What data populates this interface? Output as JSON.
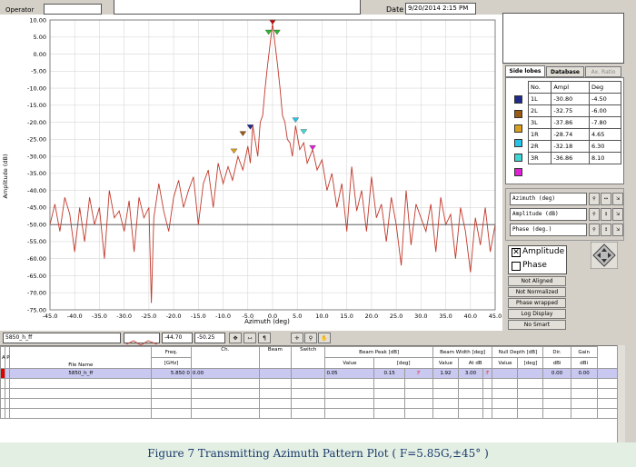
{
  "header": {
    "operator_label": "Operator",
    "operator_value": "",
    "date_label": "Date",
    "date_value": "9/20/2014 2:15 PM"
  },
  "chart_data": {
    "type": "line",
    "xlabel": "Azimuth  (deg)",
    "ylabel": "Amplitude (dB)",
    "xlim": [
      -45,
      45
    ],
    "ylim": [
      -75,
      10
    ],
    "x_ticks": [
      "-45.0",
      "-40.0",
      "-35.0",
      "-30.0",
      "-25.0",
      "-20.0",
      "-15.0",
      "-10.0",
      "-5.0",
      "0.0",
      "5.0",
      "10.0",
      "15.0",
      "20.0",
      "25.0",
      "30.0",
      "35.0",
      "40.0",
      "45.0"
    ],
    "y_ticks": [
      "10.00",
      "5.00",
      "0.00",
      "-5.00",
      "-10.00",
      "-15.00",
      "-20.00",
      "-25.00",
      "-30.00",
      "-35.00",
      "-40.00",
      "-45.00",
      "-50.00",
      "-55.00",
      "-60.00",
      "-65.00",
      "-70.00",
      "-75.00"
    ],
    "reference_line": -50,
    "grid": true,
    "series_color": "#c0392b",
    "series": [
      {
        "x": [
          -45,
          -44,
          -43,
          -42,
          -41,
          -40,
          -39,
          -38,
          -37,
          -36,
          -35,
          -34,
          -33,
          -32,
          -31,
          -30,
          -29,
          -28,
          -27,
          -26,
          -25,
          -24.5,
          -24,
          -23,
          -22,
          -21,
          -20,
          -19,
          -18,
          -17,
          -16,
          -15,
          -14,
          -13,
          -12,
          -11,
          -10,
          -9,
          -8.1,
          -7,
          -6,
          -5,
          -4.5,
          -4,
          -3,
          -2.5,
          -2,
          -1.5,
          -1,
          -0.5,
          0,
          0.5,
          1,
          1.5,
          2,
          2.5,
          3,
          3.5,
          4,
          4.65,
          5.5,
          6.3,
          7,
          8.1,
          9,
          10,
          11,
          12,
          13,
          14,
          15,
          16,
          17,
          18,
          19,
          20,
          21,
          22,
          23,
          24,
          25,
          26,
          27,
          28,
          29,
          30,
          31,
          32,
          33,
          34,
          35,
          36,
          37,
          38,
          39,
          40,
          41,
          42,
          43,
          44,
          45
        ],
        "y": [
          -50,
          -44,
          -52,
          -42,
          -47,
          -58,
          -45,
          -55,
          -42,
          -50,
          -45,
          -60,
          -40,
          -48,
          -46,
          -52,
          -43,
          -58,
          -42,
          -48,
          -45,
          -73,
          -48,
          -38,
          -46,
          -52,
          -42,
          -37,
          -45,
          -40,
          -36,
          -50,
          -38,
          -34,
          -45,
          -32,
          -38,
          -33,
          -37,
          -30,
          -34,
          -27,
          -32,
          -21,
          -30,
          -20,
          -18,
          -10,
          -3,
          3,
          9,
          3,
          -3,
          -10,
          -18,
          -20,
          -25,
          -26,
          -30,
          -21,
          -28,
          -26,
          -32,
          -28,
          -34,
          -31,
          -40,
          -35,
          -45,
          -38,
          -52,
          -33,
          -46,
          -40,
          -52,
          -36,
          -48,
          -44,
          -55,
          -42,
          -50,
          -62,
          -40,
          -56,
          -44,
          -48,
          -52,
          -44,
          -58,
          -42,
          -50,
          -47,
          -60,
          -45,
          -52,
          -64,
          -48,
          -56,
          -45,
          -58,
          -50
        ]
      }
    ],
    "markers": [
      {
        "label": "main",
        "x": 0,
        "y": 9,
        "color": "#cc0000"
      },
      {
        "label": "-3dB L",
        "x": -0.8,
        "y": 6,
        "color": "#2eb82e"
      },
      {
        "label": "-3dB R",
        "x": 0.9,
        "y": 6,
        "color": "#2eb82e"
      },
      {
        "label": "1L",
        "x": -4.5,
        "y": -21.8,
        "color": "#1f2a8a"
      },
      {
        "label": "2L",
        "x": -6,
        "y": -23.75,
        "color": "#9a5a13"
      },
      {
        "label": "3L",
        "x": -7.8,
        "y": -28.86,
        "color": "#d9a020"
      },
      {
        "label": "1R",
        "x": 4.65,
        "y": -19.74,
        "color": "#27c3e6"
      },
      {
        "label": "2R",
        "x": 6.3,
        "y": -23.18,
        "color": "#3fd6d6"
      },
      {
        "label": "3R",
        "x": 8.1,
        "y": -27.86,
        "color": "#e020d6"
      }
    ]
  },
  "sidelobes": {
    "tabs": [
      "Side lobes",
      "Database",
      "Ax. Ratio"
    ],
    "columns": [
      "No.",
      "Ampl",
      "Deg"
    ],
    "rows": [
      {
        "color": "#1f2a8a",
        "no": "1L",
        "ampl": "-30.80",
        "deg": "-4.50"
      },
      {
        "color": "#9a5a13",
        "no": "2L",
        "ampl": "-32.75",
        "deg": "-6.00"
      },
      {
        "color": "#d9a020",
        "no": "3L",
        "ampl": "-37.86",
        "deg": "-7.80"
      },
      {
        "color": "#27c3e6",
        "no": "1R",
        "ampl": "-28.74",
        "deg": "4.65"
      },
      {
        "color": "#3fd6d6",
        "no": "2R",
        "ampl": "-32.18",
        "deg": "6.30"
      },
      {
        "color": "#e020d6",
        "no": "3R",
        "ampl": "-36.86",
        "deg": "8.10"
      }
    ]
  },
  "controls": {
    "azimuth": "Azimuth  (deg)",
    "amplitude": "Amplitude (dB)",
    "phase": "Phase  (deg.)",
    "amplitude_check": "Amplitude",
    "phase_check": "Phase",
    "status": [
      "Not Aligned",
      "Not Normalized",
      "Phase wrapped",
      "Log Display",
      "No Smart"
    ]
  },
  "toolbar": {
    "file": "5850_h_ff",
    "range_from": "-44.70",
    "range_to": "-50.25"
  },
  "grid_table": {
    "headers": [
      "A",
      "P",
      "File Name",
      "Freq.",
      "Ch.",
      "Beam",
      "Switch",
      "Beam Peak [dB]",
      "Beam Width [deg]",
      "Null Depth [dB]",
      "Dir.",
      "Gain"
    ],
    "subheaders": [
      "[GHz]",
      "Value",
      "[deg]",
      "Value",
      "At dB",
      "Value",
      "[deg]",
      "dBi",
      "dBi"
    ],
    "row": {
      "file": "5850_h_ff",
      "freq": "5.850 0",
      "ch": "0.00",
      "bp_value": "0.05",
      "bp_deg": "0.15",
      "bw_value": "1.92",
      "bw_at": "3.00",
      "dir": "0.00",
      "gain": "0.00"
    }
  },
  "caption": "Figure 7    Transmitting Azimuth Pattern Plot    ( F=5.85G,±45° )"
}
